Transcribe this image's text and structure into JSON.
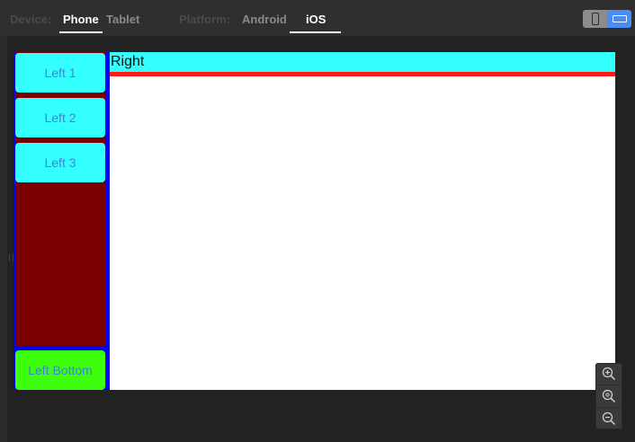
{
  "toolbar": {
    "device_label": "Device:",
    "device_options": [
      "Phone",
      "Tablet"
    ],
    "device_selected": "Phone",
    "platform_label": "Platform:",
    "platform_options": [
      "Android",
      "iOS"
    ],
    "platform_selected": "iOS",
    "orientation_icons": [
      "portrait-icon",
      "landscape-icon"
    ],
    "orientation_selected": "landscape"
  },
  "preview": {
    "left_buttons": [
      "Left 1",
      "Left 2",
      "Left 3"
    ],
    "left_bottom": "Left Bottom",
    "right_header": "Right",
    "colors": {
      "left_button_bg": "#33ffff",
      "left_panel_bg": "#7a0000",
      "divider": "#0000ff",
      "left_bottom_bg": "#3dff0d",
      "right_header_bg": "#33ffff",
      "right_header_line": "#ff1a1a",
      "right_body_bg": "#ffffff",
      "button_text": "#3b86d6"
    }
  },
  "zoom": {
    "icons": [
      "zoom-in-icon",
      "zoom-reset-icon",
      "zoom-out-icon"
    ]
  }
}
